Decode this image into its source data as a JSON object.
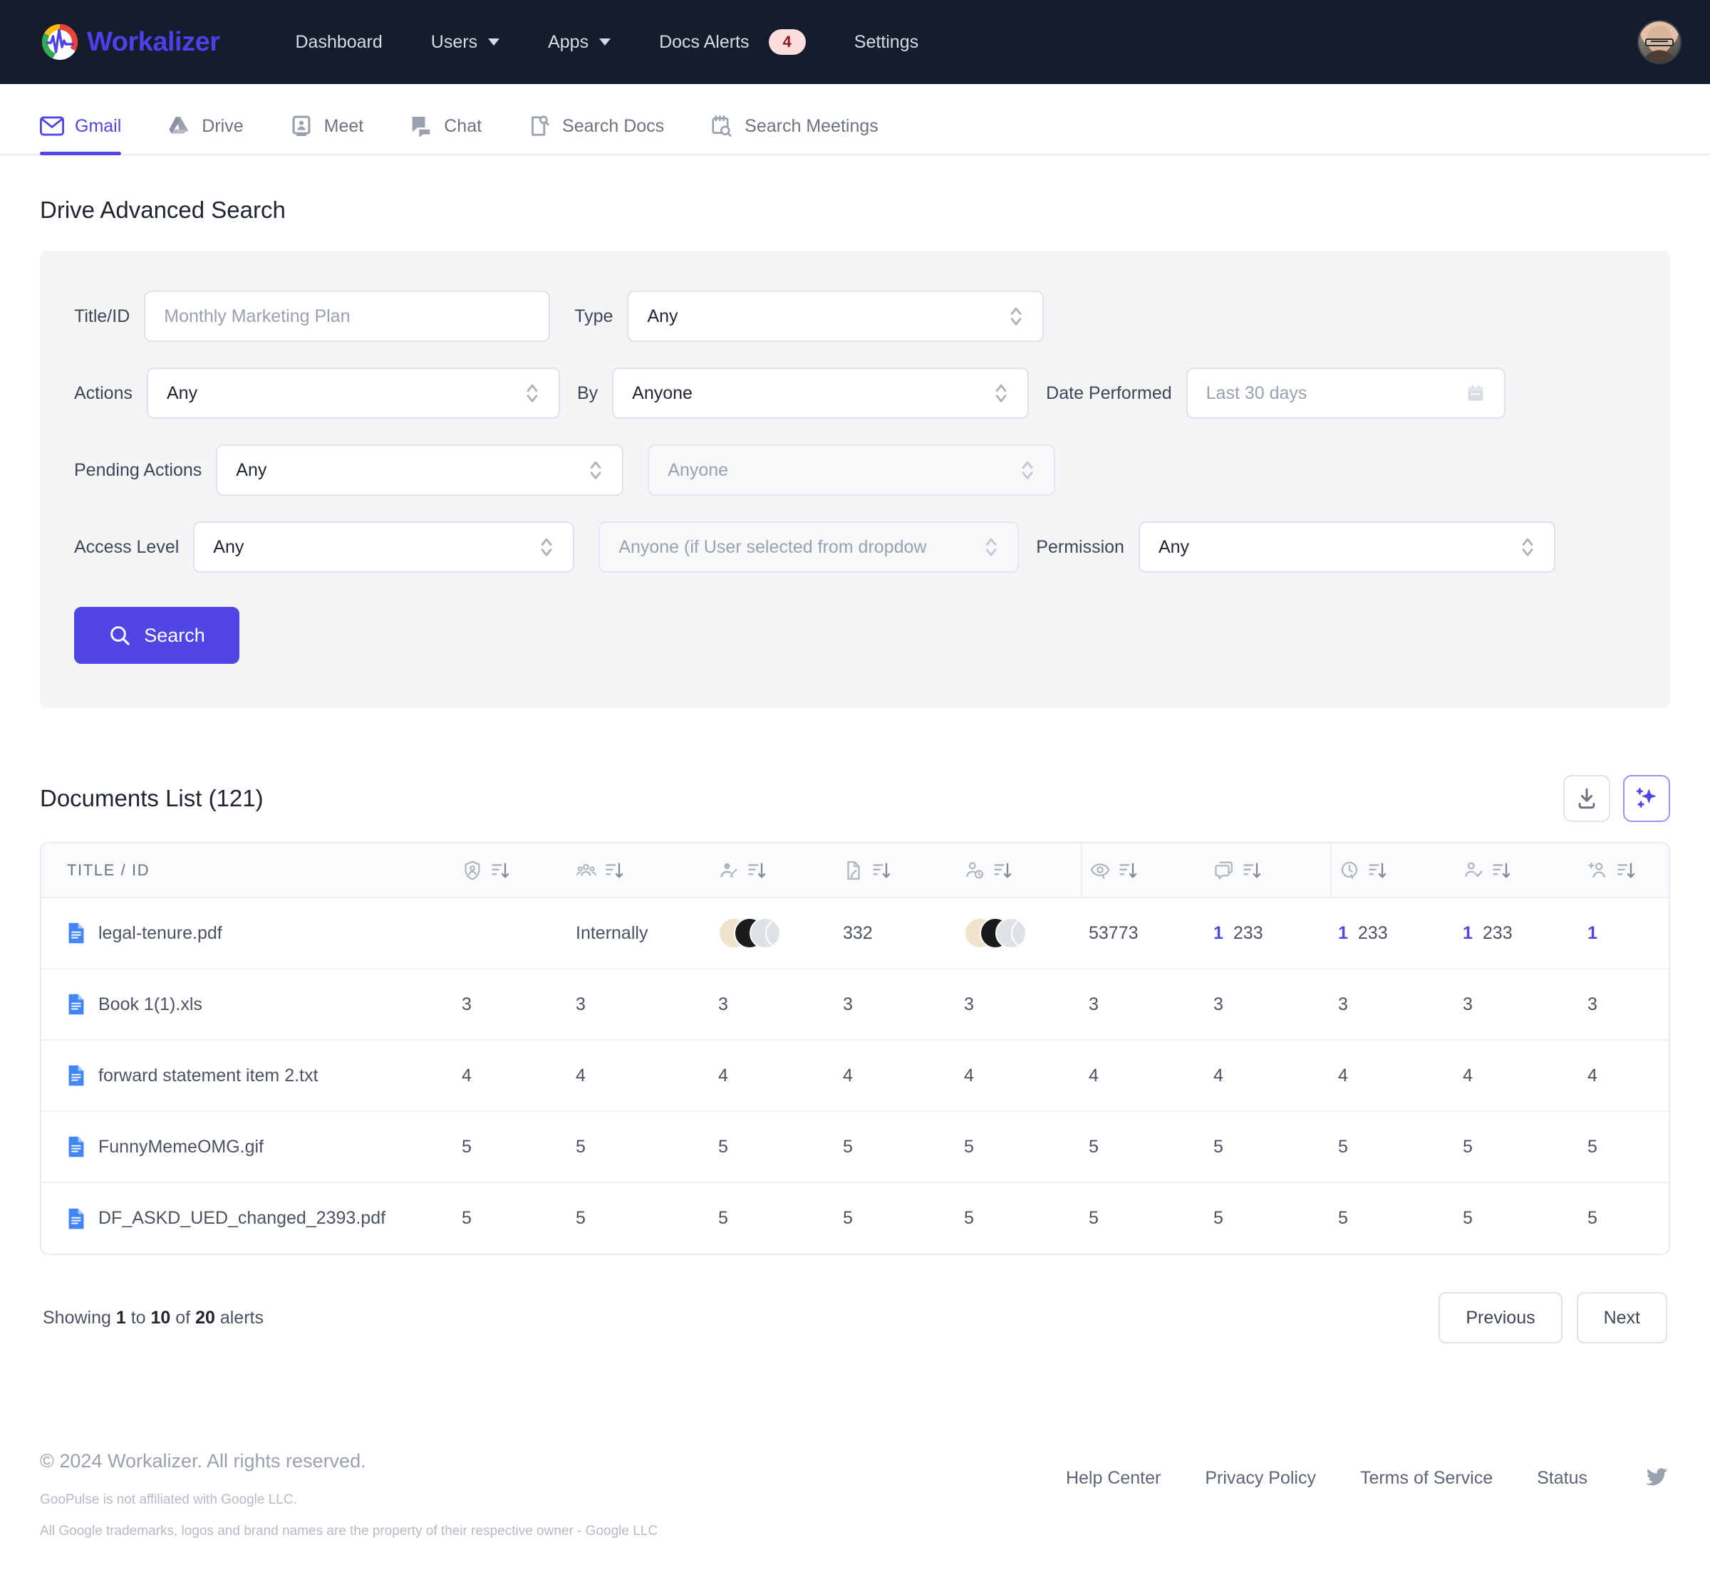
{
  "header": {
    "brand": "Workalizer",
    "brand_icon": "pulse-circle-logo",
    "nav": [
      {
        "label": "Dashboard",
        "caret": false,
        "badge": null
      },
      {
        "label": "Users",
        "caret": true,
        "badge": null
      },
      {
        "label": "Apps",
        "caret": true,
        "badge": null
      },
      {
        "label": "Docs Alerts",
        "caret": false,
        "badge": "4"
      },
      {
        "label": "Settings",
        "caret": false,
        "badge": null
      }
    ],
    "avatar_icon": "user-avatar"
  },
  "tabs": [
    {
      "label": "Gmail",
      "icon": "gmail-icon",
      "active": true
    },
    {
      "label": "Drive",
      "icon": "drive-icon",
      "active": false
    },
    {
      "label": "Meet",
      "icon": "meet-icon",
      "active": false
    },
    {
      "label": "Chat",
      "icon": "chat-icon",
      "active": false
    },
    {
      "label": "Search Docs",
      "icon": "search-docs-icon",
      "active": false
    },
    {
      "label": "Search Meetings",
      "icon": "search-meetings-icon",
      "active": false
    }
  ],
  "search": {
    "title": "Drive Advanced Search",
    "title_id_label": "Title/ID",
    "title_id_placeholder": "Monthly Marketing Plan",
    "title_id_value": "",
    "type_label": "Type",
    "type_value": "Any",
    "actions_label": "Actions",
    "actions_value": "Any",
    "by_label": "By",
    "by_value": "Anyone",
    "date_label": "Date Performed",
    "date_value": "Last 30 days",
    "pending_label": "Pending Actions",
    "pending_value": "Any",
    "pending_by_value": "Anyone",
    "access_label": "Access Level",
    "access_value": "Any",
    "access_user_value": "Anyone (if User selected from dropdow",
    "permission_label": "Permission",
    "permission_value": "Any",
    "submit_label": "Search",
    "submit_icon": "search-icon",
    "accent_color": "#4f46e5"
  },
  "documents": {
    "title": "Documents List (121)",
    "download_icon": "download-icon",
    "ai_icon": "sparkle-ai-icon",
    "columns": [
      {
        "key": "title",
        "label": "TITLE / ID",
        "icon": null
      },
      {
        "key": "owner",
        "label": "",
        "icon": "shield-user-icon"
      },
      {
        "key": "shared",
        "label": "",
        "icon": "users-group-icon"
      },
      {
        "key": "editors",
        "label": "",
        "icon": "user-edit-icon"
      },
      {
        "key": "revisions",
        "label": "",
        "icon": "file-edit-icon"
      },
      {
        "key": "viewers",
        "label": "",
        "icon": "user-clock-icon"
      },
      {
        "key": "views",
        "label": "",
        "icon": "eye-icon"
      },
      {
        "key": "comments",
        "label": "",
        "icon": "comment-icon"
      },
      {
        "key": "pending",
        "label": "",
        "icon": "clock-icon"
      },
      {
        "key": "approved",
        "label": "",
        "icon": "user-check-icon"
      },
      {
        "key": "invites",
        "label": "",
        "icon": "user-plus-icon"
      }
    ],
    "rows": [
      {
        "title": "legal-tenure.pdf",
        "owner": {
          "type": "avatar"
        },
        "shared": {
          "type": "text",
          "value": "Internally"
        },
        "editors": {
          "type": "avatar-stack"
        },
        "revisions": {
          "type": "text",
          "value": "332"
        },
        "viewers": {
          "type": "avatar-stack"
        },
        "views": {
          "type": "text",
          "value": "53773"
        },
        "comments": {
          "type": "link-text",
          "link": "1",
          "value": "233"
        },
        "pending": {
          "type": "link-text",
          "link": "1",
          "value": "233"
        },
        "approved": {
          "type": "link-text",
          "link": "1",
          "value": "233"
        },
        "invites": {
          "type": "link-text",
          "link": "1",
          "value": ""
        }
      },
      {
        "title": "Book 1(1).xls",
        "owner": {
          "type": "text",
          "value": "3"
        },
        "shared": {
          "type": "text",
          "value": "3"
        },
        "editors": {
          "type": "text",
          "value": "3"
        },
        "revisions": {
          "type": "text",
          "value": "3"
        },
        "viewers": {
          "type": "text",
          "value": "3"
        },
        "views": {
          "type": "text",
          "value": "3"
        },
        "comments": {
          "type": "text",
          "value": "3"
        },
        "pending": {
          "type": "text",
          "value": "3"
        },
        "approved": {
          "type": "text",
          "value": "3"
        },
        "invites": {
          "type": "text",
          "value": "3"
        }
      },
      {
        "title": "forward statement item 2.txt",
        "owner": {
          "type": "text",
          "value": "4"
        },
        "shared": {
          "type": "text",
          "value": "4"
        },
        "editors": {
          "type": "text",
          "value": "4"
        },
        "revisions": {
          "type": "text",
          "value": "4"
        },
        "viewers": {
          "type": "text",
          "value": "4"
        },
        "views": {
          "type": "text",
          "value": "4"
        },
        "comments": {
          "type": "text",
          "value": "4"
        },
        "pending": {
          "type": "text",
          "value": "4"
        },
        "approved": {
          "type": "text",
          "value": "4"
        },
        "invites": {
          "type": "text",
          "value": "4"
        }
      },
      {
        "title": "FunnyMemeOMG.gif",
        "owner": {
          "type": "text",
          "value": "5"
        },
        "shared": {
          "type": "text",
          "value": "5"
        },
        "editors": {
          "type": "text",
          "value": "5"
        },
        "revisions": {
          "type": "text",
          "value": "5"
        },
        "viewers": {
          "type": "text",
          "value": "5"
        },
        "views": {
          "type": "text",
          "value": "5"
        },
        "comments": {
          "type": "text",
          "value": "5"
        },
        "pending": {
          "type": "text",
          "value": "5"
        },
        "approved": {
          "type": "text",
          "value": "5"
        },
        "invites": {
          "type": "text",
          "value": "5"
        }
      },
      {
        "title": "DF_ASKD_UED_changed_2393.pdf",
        "owner": {
          "type": "text",
          "value": "5"
        },
        "shared": {
          "type": "text",
          "value": "5"
        },
        "editors": {
          "type": "text",
          "value": "5"
        },
        "revisions": {
          "type": "text",
          "value": "5"
        },
        "viewers": {
          "type": "text",
          "value": "5"
        },
        "views": {
          "type": "text",
          "value": "5"
        },
        "comments": {
          "type": "text",
          "value": "5"
        },
        "pending": {
          "type": "text",
          "value": "5"
        },
        "approved": {
          "type": "text",
          "value": "5"
        },
        "invites": {
          "type": "text",
          "value": "5"
        }
      }
    ]
  },
  "pagination": {
    "showing_prefix": "Showing ",
    "from": "1",
    "mid1": " to ",
    "to": "10",
    "mid2": " of ",
    "total": "20",
    "suffix": " alerts",
    "previous_label": "Previous",
    "next_label": "Next"
  },
  "footer": {
    "copyright": "© 2024 Workalizer. All rights reserved.",
    "disclaimer1": "GooPulse is not affiliated with Google LLC.",
    "disclaimer2": "All Google trademarks, logos and brand names are the property of their respective owner - Google LLC",
    "links": [
      "Help Center",
      "Privacy Policy",
      "Terms of Service",
      "Status"
    ],
    "social_icon": "twitter-icon"
  }
}
